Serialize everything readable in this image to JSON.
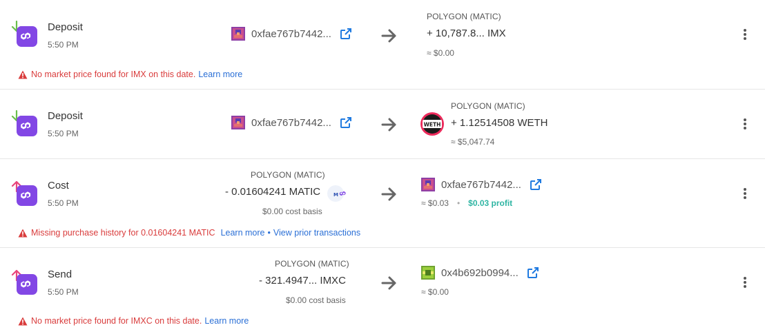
{
  "colors": {
    "polygon_purple": "#8247e5",
    "deposit_arrow": "#6abf4b",
    "send_arrow": "#e8457c",
    "warning": "#d93c3c",
    "link": "#2a6fd6",
    "profit": "#2fb5a3"
  },
  "transactions": [
    {
      "type": "Deposit",
      "time": "5:50 PM",
      "from_address": "0xfae767b7442...",
      "to_network": "POLYGON (MATIC)",
      "to_amount": "+ 10,787.8... IMX",
      "to_value": "≈ $0.00",
      "warning": "No market price found for IMX on this date.",
      "learn_more": "Learn more"
    },
    {
      "type": "Deposit",
      "time": "5:50 PM",
      "from_address": "0xfae767b7442...",
      "to_network": "POLYGON (MATIC)",
      "to_amount": "+ 1.12514508 WETH",
      "to_value": "≈ $5,047.74",
      "to_token_icon": "weth-icon",
      "to_token_text": "WETH"
    },
    {
      "type": "Cost",
      "time": "5:50 PM",
      "from_network": "POLYGON (MATIC)",
      "from_amount": "- 0.01604241 MATIC",
      "from_cost_basis": "$0.00 cost basis",
      "to_address": "0xfae767b7442...",
      "to_value": "≈ $0.03",
      "profit": "$0.03 profit",
      "warning": "Missing purchase history for 0.01604241 MATIC",
      "learn_more": "Learn more",
      "separator": "•",
      "view_prior": "View prior transactions"
    },
    {
      "type": "Send",
      "time": "5:50 PM",
      "from_network": "POLYGON (MATIC)",
      "from_amount": "- 321.4947... IMXC",
      "from_cost_basis": "$0.00 cost basis",
      "to_address": "0x4b692b0994...",
      "to_value": "≈ $0.00",
      "warning": "No market price found for IMXC on this date.",
      "learn_more": "Learn more"
    }
  ]
}
